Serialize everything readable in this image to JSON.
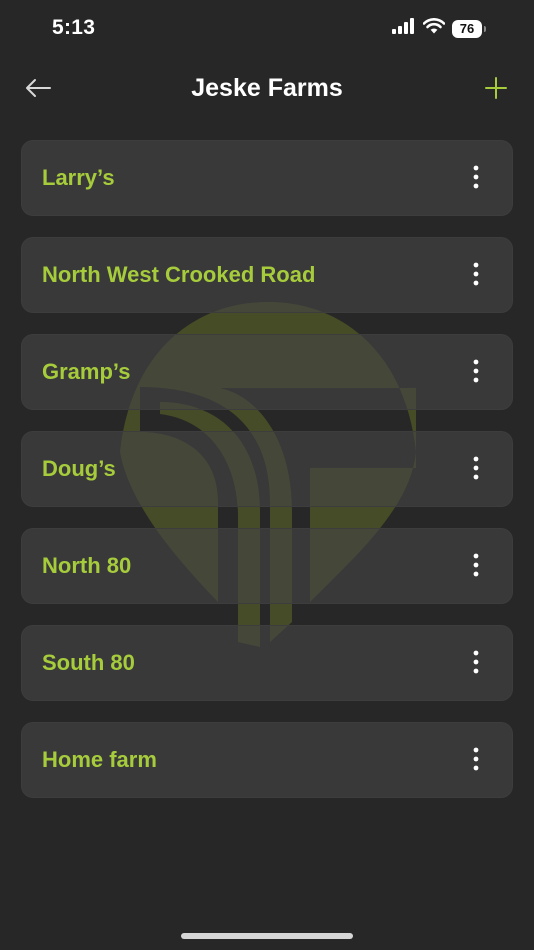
{
  "status_bar": {
    "time": "5:13",
    "battery_level": "76",
    "icons": [
      "signal-icon",
      "wifi-icon",
      "battery-icon"
    ]
  },
  "header": {
    "title": "Jeske Farms",
    "back_icon": "arrow-left-icon",
    "add_icon": "plus-icon"
  },
  "fields": [
    {
      "name": "Larry’s"
    },
    {
      "name": "North West Crooked Road"
    },
    {
      "name": "Gramp’s"
    },
    {
      "name": "Doug’s"
    },
    {
      "name": "North 80"
    },
    {
      "name": "South 80"
    },
    {
      "name": "Home farm"
    }
  ],
  "theme": {
    "background": "#272727",
    "card": "#464646",
    "accent": "#a6cc3c",
    "text": "#ffffff"
  }
}
